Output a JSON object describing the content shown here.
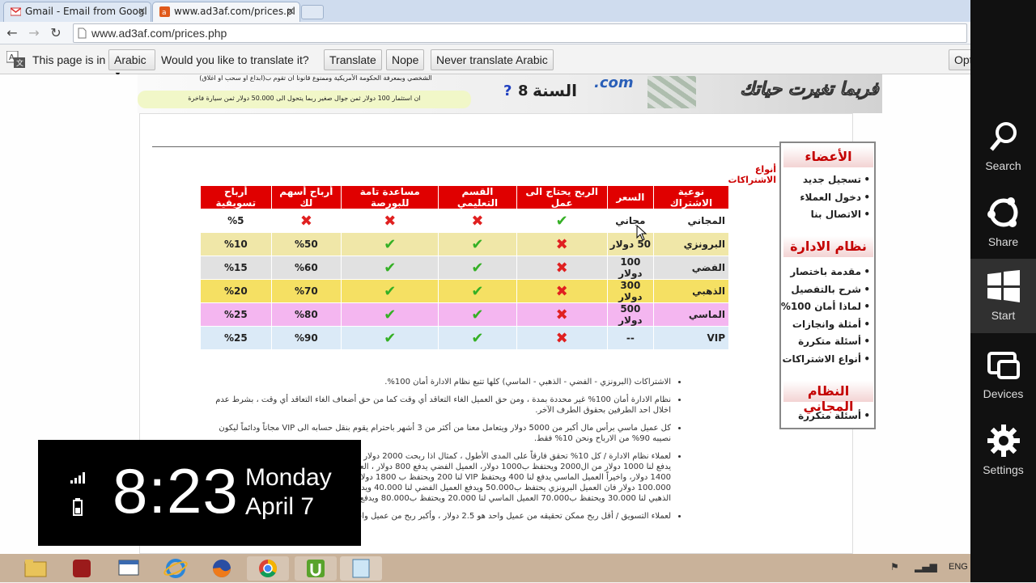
{
  "browser": {
    "tabs": [
      {
        "label": "Gmail - Email from Googl",
        "active": false
      },
      {
        "label": "www.ad3af.com/prices.pl",
        "active": true
      }
    ],
    "url": "www.ad3af.com/prices.php"
  },
  "translate_bar": {
    "prompt": "This page is in",
    "language": "Arabic",
    "question": "Would you like to translate it?",
    "translate_label": "Translate",
    "nope_label": "Nope",
    "never_label": "Never translate Arabic",
    "options_label": "Opt"
  },
  "banner": {
    "line1": "الشخصي وبمعرفة الحكومة الأمريكية وممنوع قانونا ان تقوم ب(ابداع او سحب او اغلاق)",
    "line2": "ان استثمار 100 دولار ثمن جوال صغير ربما يتحول الى 50.000 دولار ثمن سيارة فاخرة",
    "year_text": "السنة",
    "year_num": "8",
    "question": "?",
    "logo": ".com",
    "slogan": "فربما تغيرت حياتك"
  },
  "section_title": "أنواع الاشتراكات",
  "pricing": {
    "headers": [
      "نوعية الاشتراك",
      "السعر",
      "الربح يحتاج الى عمل",
      "القسم التعليمي",
      "مساعدة تامة للبورصة",
      "أرباح أسهم لك",
      "أرباح تسويقية"
    ],
    "rows": [
      {
        "name": "المجاني",
        "price": "مجاني",
        "work": "check",
        "edu": "cross",
        "help": "cross",
        "shares": "cross",
        "marketing": "%5",
        "color": "#ffffff"
      },
      {
        "name": "البرونزي",
        "price": "50 دولار",
        "work": "cross",
        "edu": "check",
        "help": "check",
        "shares": "%50",
        "marketing": "%10",
        "color": "#f0e7a8"
      },
      {
        "name": "الفضي",
        "price": "100 دولار",
        "work": "cross",
        "edu": "check",
        "help": "check",
        "shares": "%60",
        "marketing": "%15",
        "color": "#e1e1e1"
      },
      {
        "name": "الذهبي",
        "price": "300 دولار",
        "work": "cross",
        "edu": "check",
        "help": "check",
        "shares": "%70",
        "marketing": "%20",
        "color": "#f5e063"
      },
      {
        "name": "الماسي",
        "price": "500 دولار",
        "work": "cross",
        "edu": "check",
        "help": "check",
        "shares": "%80",
        "marketing": "%25",
        "color": "#f4b6f0"
      },
      {
        "name": "VIP",
        "price": "--",
        "work": "cross",
        "edu": "check",
        "help": "check",
        "shares": "%90",
        "marketing": "%25",
        "color": "#dbeaf7"
      }
    ]
  },
  "notes": [
    "الاشتراكات (البرونزي - الفضي - الذهبي - الماسي) كلها تتبع نظام الادارة أمان 100%.",
    "نظام الادارة أمان 100% غير محددة بمدة ، ومن حق العميل الغاء التعاقد أي وقت كما من حق أضعاف الغاء التعاقد أي وقت ، بشرط عدم اخلال احد الطرفين بحقوق الطرف الآخر.",
    "كل عميل ماسي برأس مال أكبر من 5000 دولار ويتعامل معنا من أكثر من 3 أشهر باحترام يقوم بنقل حسابه الى VIP مجاناً ودائماً ليكون نصيبه 90% من الارباح ونحن 10% فقط.",
    "لعملاء نظام الادارة / كل 10% تحقق فارقاً على المدى الأطول ، كمثال اذا ربحت 2000 دولار فان العميل 200 دولار ، العميل البرونزي يدفع لنا 1000 دولار من ال2000 ويحتفظ ب1000 دولار، العميل الفضي يدفع 800 دولار ، العميل الذهبي يدفع لنا 600 دولار ويحتفظ ب 1400 دولار، واخيراً العميل الماسي يدفع لنا 400 ويحتفظ VIP لنا 200 ويحتفظ ب 1800 دولار. وكمثال على أرقام كبيرة ، فان ربح 100.000 دولار فان العميل البرونزي يحتفظ ب50.000 ويدفع العميل الفضي لنا 40.000 ويدفع العميل الذهبي 60.000 ويدفع العميل الذهبي لنا 30.000 ويحتفظ ب70.000 العميل الماسي لنا 20.000 ويحتفظ ب80.000 ويدفع عميل VIP لنا 10.000 ويحتفظ ب 90.000",
    "لعملاء التسويق / أقل ربح ممكن تحقيقه من عميل واحد هو 2.5 دولار ، وأكبر ربح من عميل واحد"
  ],
  "sidebar": {
    "members_title": "الأعضاء",
    "members": [
      "تسجيل جديد",
      "دخول العملاء",
      "الاتصال بنا"
    ],
    "admin_title": "نظام الادارة",
    "admin": [
      "مقدمة باختصار",
      "شرح بالتفصيل",
      "لماذا أمان 100%",
      "أمثلة وانجازات",
      "أسئلة متكررة",
      "أنواع الاشتراكات"
    ],
    "free_title": "النظام المجاني",
    "free": [
      "أسئلة متكررة"
    ]
  },
  "charms": [
    {
      "label": "Search",
      "icon": "search-icon"
    },
    {
      "label": "Share",
      "icon": "share-icon"
    },
    {
      "label": "Start",
      "icon": "windows-logo-icon"
    },
    {
      "label": "Devices",
      "icon": "devices-icon"
    },
    {
      "label": "Settings",
      "icon": "gear-icon"
    }
  ],
  "clock": {
    "time": "8:23",
    "day": "Monday",
    "date": "April 7"
  },
  "tray": {
    "lang": "ENG"
  }
}
